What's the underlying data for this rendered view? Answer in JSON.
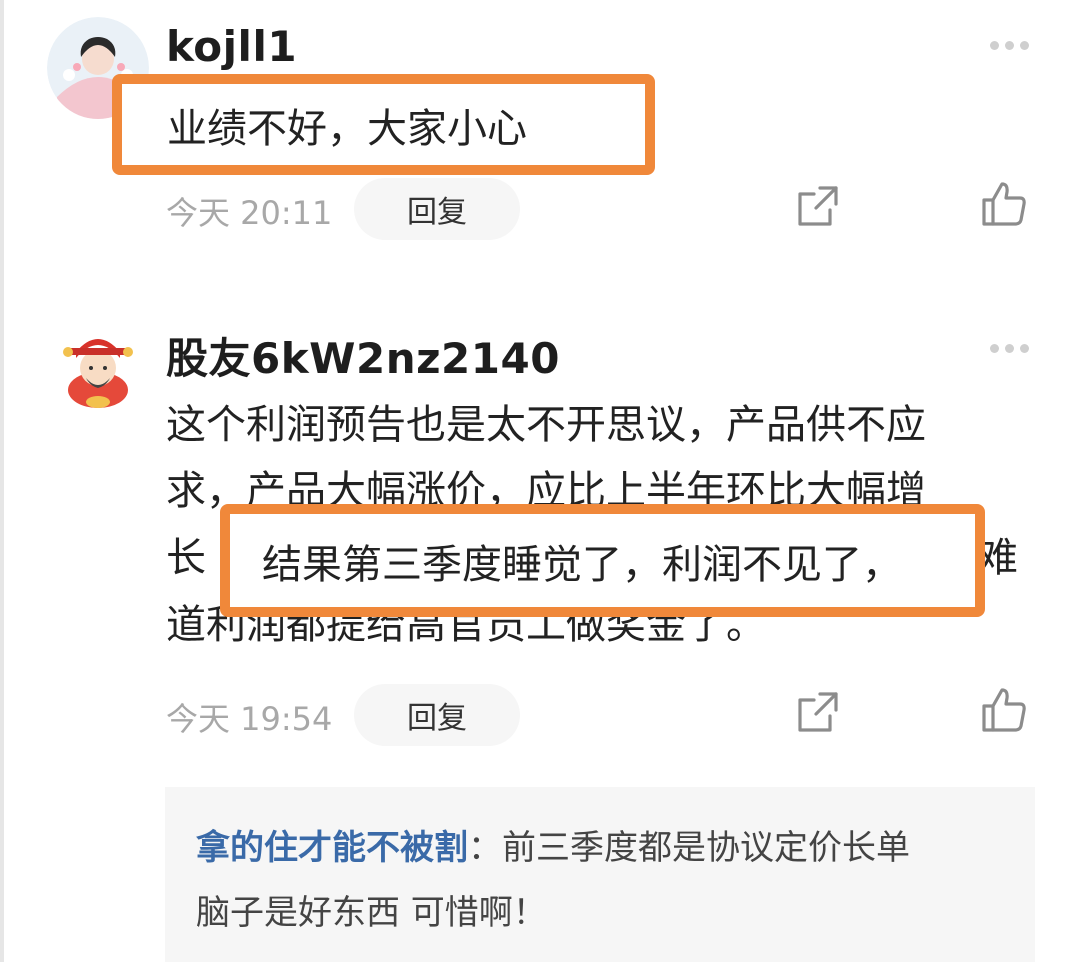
{
  "comments": [
    {
      "username": "kojll1",
      "text": "业绩不好，大家小心",
      "time": "今天 20:11",
      "reply_label": "回复"
    },
    {
      "username": "股友6kW2nz2140",
      "lines": [
        "这个利润预告也是太不开思议，产品供不应",
        "求，产品大幅涨价，应比上半年环比大幅增",
        "长，结果第三季度睡觉了，利润不见了，难",
        "道利润都提给高官员工做奖金了。"
      ],
      "line3_prefix": "长",
      "line3_highlight": "结果第三季度睡觉了，利润不见了，",
      "line3_suffix": "难",
      "time": "今天 19:54",
      "reply_label": "回复",
      "sub_reply": {
        "author": "拿的住才能不被割",
        "separator": "：",
        "line1_text": "前三季度都是协议定价长单",
        "line2_text": "脑子是好东西 可惜啊！"
      }
    }
  ],
  "colors": {
    "highlight_border": "#f0883a",
    "sub_author": "#3a6aa8"
  },
  "icons": [
    "more-icon",
    "share-icon",
    "like-icon",
    "avatar-woman",
    "avatar-caishen"
  ]
}
